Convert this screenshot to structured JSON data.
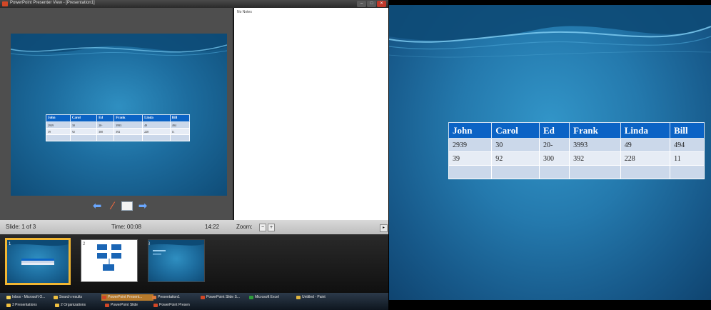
{
  "window": {
    "title": "PowerPoint Presenter View - [Presentation1]",
    "min_symbol": "–",
    "max_symbol": "□",
    "close_symbol": "✕"
  },
  "slide_table": {
    "headers": [
      "John",
      "Carol",
      "Ed",
      "Frank",
      "Linda",
      "Bill"
    ],
    "rows": [
      [
        "2939",
        "30",
        "20-",
        "3993",
        "49",
        "494"
      ],
      [
        "39",
        "92",
        "300",
        "392",
        "228",
        "11"
      ],
      [
        "",
        "",
        "",
        "",
        "",
        ""
      ]
    ]
  },
  "nav": {
    "prev_icon": "arrow-left-icon",
    "pen_icon": "pen-icon",
    "menu_icon": "slide-menu-icon",
    "next_icon": "arrow-right-icon"
  },
  "notes": {
    "text": "No Notes"
  },
  "status": {
    "slide": "Slide: 1 of 3",
    "time": "Time: 00:08",
    "clock": "14:22",
    "zoom_label": "Zoom:",
    "zoom_minus": "−",
    "zoom_plus": "+"
  },
  "thumbnails": [
    {
      "number": "1"
    },
    {
      "number": "2"
    },
    {
      "number": "3"
    }
  ],
  "taskbar": {
    "row1": [
      "Inbox - Microsoft O...",
      "Search results",
      "PowerPoint Present...",
      "Presentation1",
      "PowerPoint Slide S...",
      "Microsoft Excel",
      "Untitled - Paint"
    ],
    "row2": [
      "3 Presentations",
      "2 Organizations",
      "PowerPoint Slide",
      "PowerPoint Presen"
    ]
  },
  "colors": {
    "header_blue": "#0b63c5",
    "thumb_highlight": "#f2b632",
    "slide_bg": "#2479ad"
  }
}
